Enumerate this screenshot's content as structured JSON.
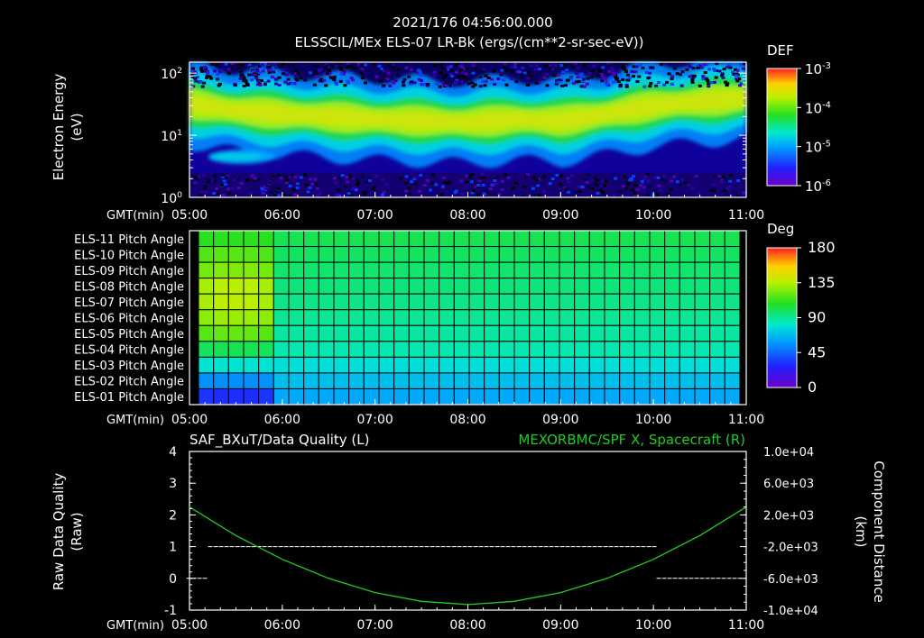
{
  "header": {
    "timestamp": "2021/176 04:56:00.000",
    "product": "ELSSCIL/MEx ELS-07 LR-Bk  (ergs/(cm**2-sr-sec-eV))"
  },
  "time_axis": {
    "label": "GMT(min)",
    "ticks": [
      "05:00",
      "06:00",
      "07:00",
      "08:00",
      "09:00",
      "10:00",
      "11:00"
    ]
  },
  "chart_data": [
    {
      "type": "heatmap",
      "title": "ELSSCIL/MEx ELS-07 LR-Bk  (ergs/(cm**2-sr-sec-eV))",
      "ylabel": "Electron Energy (eV)",
      "ylabel_lines": [
        "Electron Energy",
        "(eV)"
      ],
      "yscale": "log",
      "ylim": [
        1,
        150
      ],
      "y_ticks": [
        {
          "base": "10",
          "exp": "0"
        },
        {
          "base": "10",
          "exp": "1"
        },
        {
          "base": "10",
          "exp": "2"
        }
      ],
      "xlim": [
        "05:00",
        "11:00"
      ],
      "colorbar": {
        "title": "DEF",
        "scale": "log",
        "range": [
          1e-06,
          0.001
        ],
        "ticks": [
          {
            "base": "10",
            "exp": "-3"
          },
          {
            "base": "10",
            "exp": "-4"
          },
          {
            "base": "10",
            "exp": "-5"
          },
          {
            "base": "10",
            "exp": "-6"
          }
        ]
      },
      "features": {
        "peak_energy_ev_by_hour": [
          {
            "time": "05:00",
            "ev": 32
          },
          {
            "time": "05:30",
            "ev": 25
          },
          {
            "time": "06:00",
            "ev": 22
          },
          {
            "time": "07:00",
            "ev": 18
          },
          {
            "time": "08:00",
            "ev": 16
          },
          {
            "time": "08:30",
            "ev": 18
          },
          {
            "time": "09:00",
            "ev": 17
          },
          {
            "time": "09:30",
            "ev": 22
          },
          {
            "time": "10:00",
            "ev": 30
          },
          {
            "time": "11:00",
            "ev": 40
          }
        ],
        "secondary_population": {
          "time_range": [
            "05:12",
            "05:55"
          ],
          "ev": 4.5
        }
      }
    },
    {
      "type": "heatmap",
      "title": "",
      "ylabel": "",
      "rows": [
        "ELS-11 Pitch Angle",
        "ELS-10 Pitch Angle",
        "ELS-09 Pitch Angle",
        "ELS-08 Pitch Angle",
        "ELS-07 Pitch Angle",
        "ELS-06 Pitch Angle",
        "ELS-05 Pitch Angle",
        "ELS-04 Pitch Angle",
        "ELS-03 Pitch Angle",
        "ELS-02 Pitch Angle",
        "ELS-01 Pitch Angle"
      ],
      "xlim": [
        "05:00",
        "11:00"
      ],
      "columns": 36,
      "colorbar": {
        "title": "Deg",
        "range": [
          0,
          180
        ],
        "ticks": [
          "180",
          "135",
          "90",
          "45",
          "0"
        ]
      },
      "pitch_angle_deg_early": [
        110,
        118,
        125,
        135,
        135,
        130,
        120,
        100,
        80,
        55,
        30
      ],
      "pitch_angle_deg_late": [
        100,
        98,
        96,
        94,
        92,
        90,
        88,
        86,
        78,
        68,
        62
      ]
    },
    {
      "type": "line",
      "title": "SAF_BXuT/Data Quality (L)",
      "title_right": "MEXORBMC/SPF X, Spacecraft (R)",
      "ylabel": "Raw Data Quality (Raw)",
      "ylabel_lines": [
        "Raw Data Quality",
        "(Raw)"
      ],
      "ylim": [
        -1,
        4
      ],
      "y_ticks": [
        "4",
        "3",
        "2",
        "1",
        "0",
        "-1"
      ],
      "y2label": "Component Distance (km)",
      "y2label_lines": [
        "Component Distance",
        "(km)"
      ],
      "y2lim": [
        -10000,
        10000
      ],
      "y2_ticks": [
        "1.0e+04",
        "6.0e+03",
        "2.0e+03",
        "-2.0e+03",
        "-6.0e+03",
        "-1.0e+04"
      ],
      "xlim": [
        "05:00",
        "11:00"
      ],
      "series": [
        {
          "name": "SAF_BXuT/Data Quality",
          "axis": "left",
          "color": "#ffffff",
          "segments": [
            {
              "x": [
                "04:58",
                "05:12"
              ],
              "y": 0
            },
            {
              "x": [
                "05:12",
                "10:02"
              ],
              "y": 1
            },
            {
              "x": [
                "10:02",
                "10:57"
              ],
              "y": 0
            }
          ]
        },
        {
          "name": "MEXORBMC/SPF X, Spacecraft",
          "axis": "right",
          "color": "#22cc22",
          "x": [
            "05:00",
            "05:30",
            "06:00",
            "06:30",
            "07:00",
            "07:30",
            "08:00",
            "08:30",
            "09:00",
            "09:30",
            "10:00",
            "10:30",
            "11:00"
          ],
          "y": [
            3000,
            -600,
            -3600,
            -6000,
            -7800,
            -8900,
            -9300,
            -8900,
            -7800,
            -6000,
            -3600,
            -600,
            3000
          ]
        }
      ]
    }
  ]
}
